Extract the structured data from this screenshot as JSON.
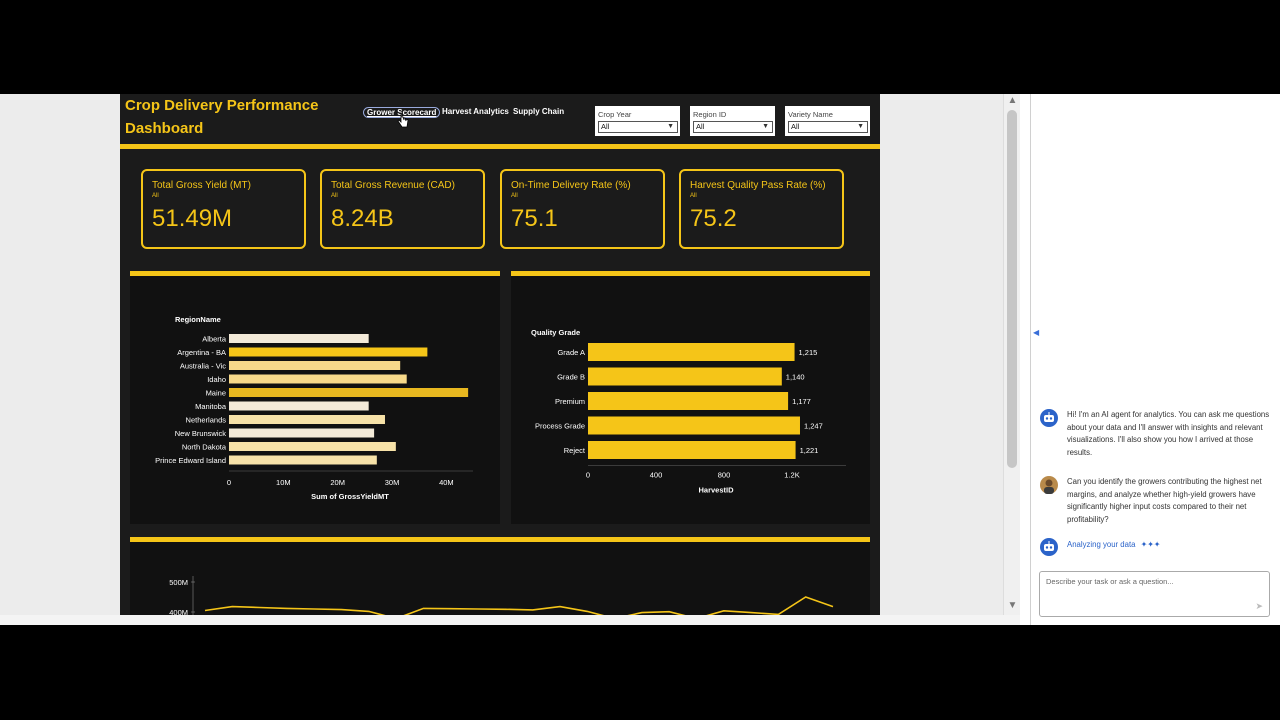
{
  "dashboard": {
    "title": "Crop Delivery Performance Dashboard",
    "tabs": [
      {
        "label": "Grower Scorecard",
        "active": true
      },
      {
        "label": "Harvest Analytics",
        "active": false
      },
      {
        "label": "Supply Chain",
        "active": false
      }
    ],
    "filters": [
      {
        "label": "Crop Year",
        "value": "All"
      },
      {
        "label": "Region ID",
        "value": "All"
      },
      {
        "label": "Variety Name",
        "value": "All"
      }
    ],
    "accent_color": "#f5c518",
    "kpis": [
      {
        "title": "Total Gross Yield (MT)",
        "sub": "All",
        "value": "51.49M"
      },
      {
        "title": "Total Gross Revenue (CAD)",
        "sub": "All",
        "value": "8.24B"
      },
      {
        "title": "On-Time Delivery Rate (%)",
        "sub": "All",
        "value": "75.1"
      },
      {
        "title": "Harvest Quality Pass Rate (%)",
        "sub": "All",
        "value": "75.2"
      }
    ]
  },
  "chart_data": [
    {
      "type": "bar",
      "orientation": "horizontal",
      "category_label": "RegionName",
      "categories": [
        "Alberta",
        "Argentina - BA",
        "Australia - Vic",
        "Idaho",
        "Maine",
        "Manitoba",
        "Netherlands",
        "New Brunswick",
        "North Dakota",
        "Prince Edward Island"
      ],
      "values": [
        25700000,
        36500000,
        31500000,
        32700000,
        44000000,
        25700000,
        28700000,
        26700000,
        30700000,
        27200000
      ],
      "xlabel": "Sum of GrossYieldMT",
      "xticks": [
        "0",
        "10M",
        "20M",
        "30M",
        "40M"
      ],
      "xlim": [
        0,
        46000000
      ]
    },
    {
      "type": "bar",
      "orientation": "horizontal",
      "category_label": "Quality Grade",
      "categories": [
        "Grade A",
        "Grade B",
        "Premium",
        "Process Grade",
        "Reject"
      ],
      "values": [
        1215,
        1140,
        1177,
        1247,
        1221
      ],
      "data_labels": [
        "1,215",
        "1,140",
        "1,177",
        "1,247",
        "1,221"
      ],
      "xlabel": "HarvestID",
      "xticks": [
        "0",
        "400",
        "800",
        "1.2K"
      ],
      "xlim": [
        0,
        1400
      ]
    },
    {
      "type": "line",
      "yticks": [
        "500M",
        "400M"
      ],
      "ylim": [
        300000000,
        500000000
      ],
      "values": [
        405000000,
        418000000,
        415000000,
        412000000,
        410000000,
        408000000,
        402000000,
        378000000,
        412000000,
        411000000,
        410000000,
        409000000,
        407000000,
        418000000,
        402000000,
        378000000,
        398000000,
        401000000,
        378000000,
        404000000,
        398000000,
        392000000,
        450000000,
        418000000
      ]
    }
  ],
  "chat": {
    "messages": [
      {
        "from": "agent",
        "text": "Hi! I'm an AI agent for analytics. You can ask me questions about your data and I'll answer with insights and relevant visualizations. I'll also show you how I arrived at those results."
      },
      {
        "from": "user",
        "text": "Can you identify the growers contributing the highest net margins, and analyze whether high-yield growers have significantly higher input costs compared to their net profitability?"
      }
    ],
    "status": "Analyzing your data",
    "status_dots": "✦✦✦",
    "input_placeholder": "Describe your task or ask a question...",
    "collapse_arrow": "◀",
    "send_icon": "➤"
  },
  "scroll": {
    "up": "▲",
    "down": "▼"
  }
}
